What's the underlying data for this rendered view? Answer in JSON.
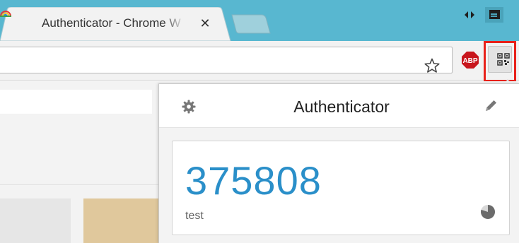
{
  "browser": {
    "tab": {
      "title": "Authenticator - Chrome W",
      "close_glyph": "✕",
      "favicon": "rainbow-icon"
    },
    "icons": {
      "window_control_a": "swap-arrows-icon",
      "window_control_b": "profile-window-icon",
      "bookmark": "star-icon",
      "adblock": "adblock-plus-icon",
      "extension": "qr-code-icon"
    },
    "adblock_label": "ABP"
  },
  "popup": {
    "title": "Authenticator",
    "settings_icon": "gear-icon",
    "edit_icon": "pencil-icon",
    "entries": [
      {
        "code": "375808",
        "account": "test",
        "timer_icon": "countdown-pie-icon",
        "timer_fraction_remaining": 0.8
      }
    ]
  },
  "colors": {
    "tab_strip": "#58b7d0",
    "code_text": "#2a8fc9",
    "highlight_box": "#e8211a",
    "adblock_red": "#c8161d"
  }
}
